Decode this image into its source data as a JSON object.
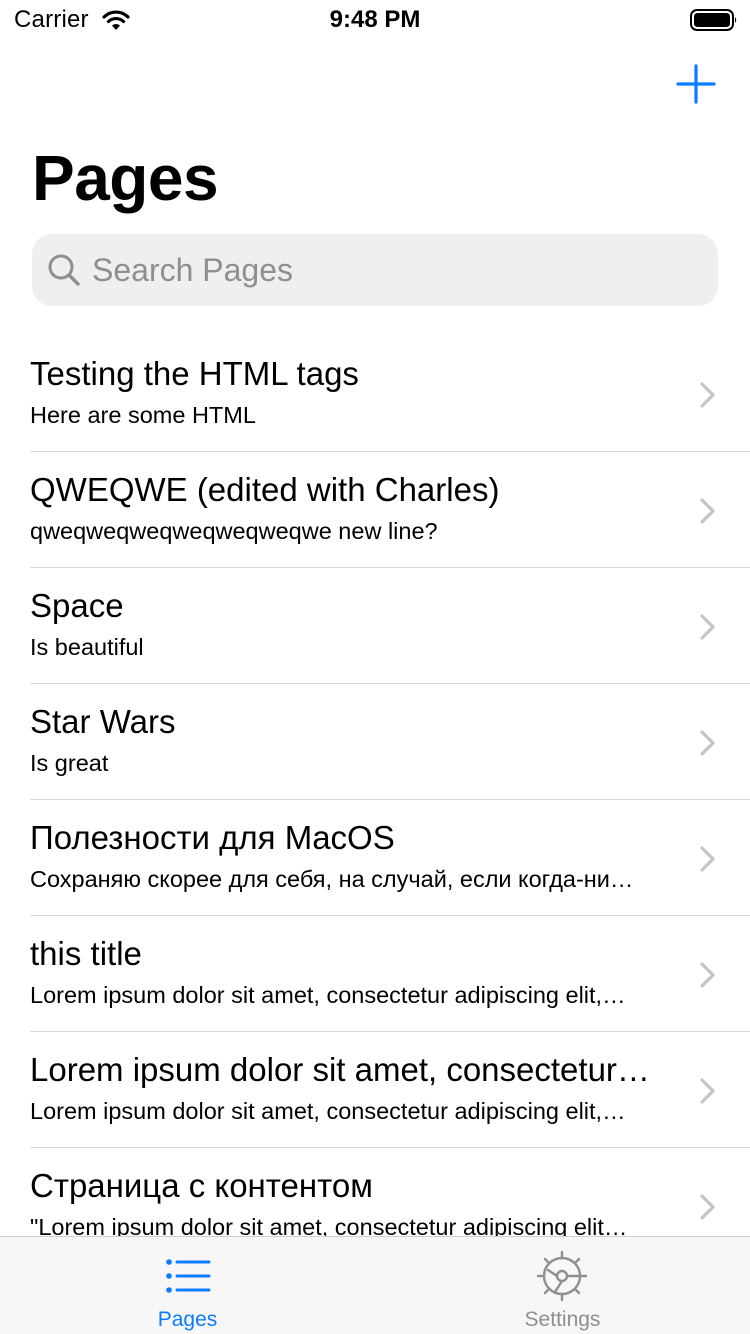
{
  "status_bar": {
    "carrier": "Carrier",
    "time": "9:48 PM"
  },
  "nav": {
    "title": "Pages",
    "add_icon": "plus-icon"
  },
  "search": {
    "placeholder": "Search Pages",
    "value": ""
  },
  "pages": [
    {
      "title": "Testing the HTML tags",
      "subtitle": "Here are some HTML"
    },
    {
      "title": "QWEQWE (edited with Charles)",
      "subtitle": "qweqweqweqweqweqweqwe new line?"
    },
    {
      "title": "Space",
      "subtitle": "Is beautiful"
    },
    {
      "title": "Star Wars",
      "subtitle": "Is great"
    },
    {
      "title": "Полезности для MacOS",
      "subtitle": "Сохраняю скорее для себя, на случай, если когда-ни…"
    },
    {
      "title": "this title",
      "subtitle": "Lorem ipsum dolor sit amet, consectetur adipiscing elit,…"
    },
    {
      "title": "Lorem ipsum dolor sit amet, consectetur…",
      "subtitle": "Lorem ipsum dolor sit amet, consectetur adipiscing elit,…"
    },
    {
      "title": "Страница с контентом",
      "subtitle": "\"Lorem ipsum dolor sit amet, consectetur adipiscing elit…"
    }
  ],
  "tabs": [
    {
      "label": "Pages",
      "icon": "list-icon",
      "selected": true
    },
    {
      "label": "Settings",
      "icon": "gear-icon",
      "selected": false
    }
  ],
  "colors": {
    "accent": "#0a7cff",
    "inactive_tab": "#8e8e93",
    "chevron": "#c4c4c7",
    "separator": "#d8d8dc",
    "search_bg": "#efeff0"
  }
}
